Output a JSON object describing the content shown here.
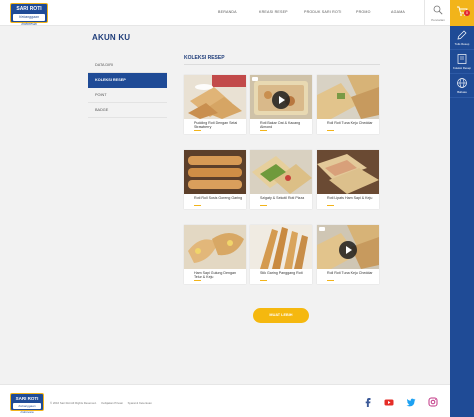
{
  "brand": {
    "name": "SARI ROTI",
    "tagline": "Kebanggaan Indonesia"
  },
  "nav": [
    "Beranda",
    "Kreasi Resep",
    "Produk Sari Roti",
    "Promo",
    "Agama"
  ],
  "search": {
    "label": "Pencarian"
  },
  "cart": {
    "count": "0"
  },
  "rail": [
    {
      "icon": "edit-icon",
      "label": "Tulis Resep"
    },
    {
      "icon": "recipe-book-icon",
      "label": "Koleksi Resep"
    },
    {
      "icon": "globe-icon",
      "label": "Bahasa"
    }
  ],
  "page": {
    "title": "AKUN KU"
  },
  "side_menu": [
    {
      "label": "Data Diri",
      "active": false
    },
    {
      "label": "Koleksi Resep",
      "active": true
    },
    {
      "label": "Point",
      "active": false
    },
    {
      "label": "Badge",
      "active": false
    }
  ],
  "section": {
    "title": "Koleksi Resep"
  },
  "recipes": [
    {
      "name": "Pudding Roti Dengan Selai Strawberry",
      "video": false
    },
    {
      "name": "Roti Bakar Oat & Kacang Almond",
      "video": true
    },
    {
      "name": "Roll Roti Tuna Keju Cheddar",
      "video": false
    },
    {
      "name": "Roti Roll Sosis Goreng Garing",
      "video": false
    },
    {
      "name": "Szigaty & Sekotil Roti Pizza",
      "video": false
    },
    {
      "name": "Roti Lipats Ham Sapi & Keju",
      "video": false
    },
    {
      "name": "Ham Sapi Gulung Dengan Telur & Keju",
      "video": false
    },
    {
      "name": "Stik Garing Panggang Roti",
      "video": false
    },
    {
      "name": "Roll Roti Tuna Keju Cheddar",
      "video": true
    }
  ],
  "more_button": "Muat Lebih",
  "footer": {
    "copyright": "© 2016 Sari Roti All Rights Reserved.",
    "links": [
      "Kebijakan Privasi",
      "Syarat & Ketentuan"
    ],
    "social": [
      "facebook-icon",
      "youtube-icon",
      "twitter-icon",
      "instagram-icon"
    ]
  },
  "colors": {
    "navy": "#1f4b96",
    "accent": "#f2b41a",
    "title": "#1f3d7a"
  }
}
